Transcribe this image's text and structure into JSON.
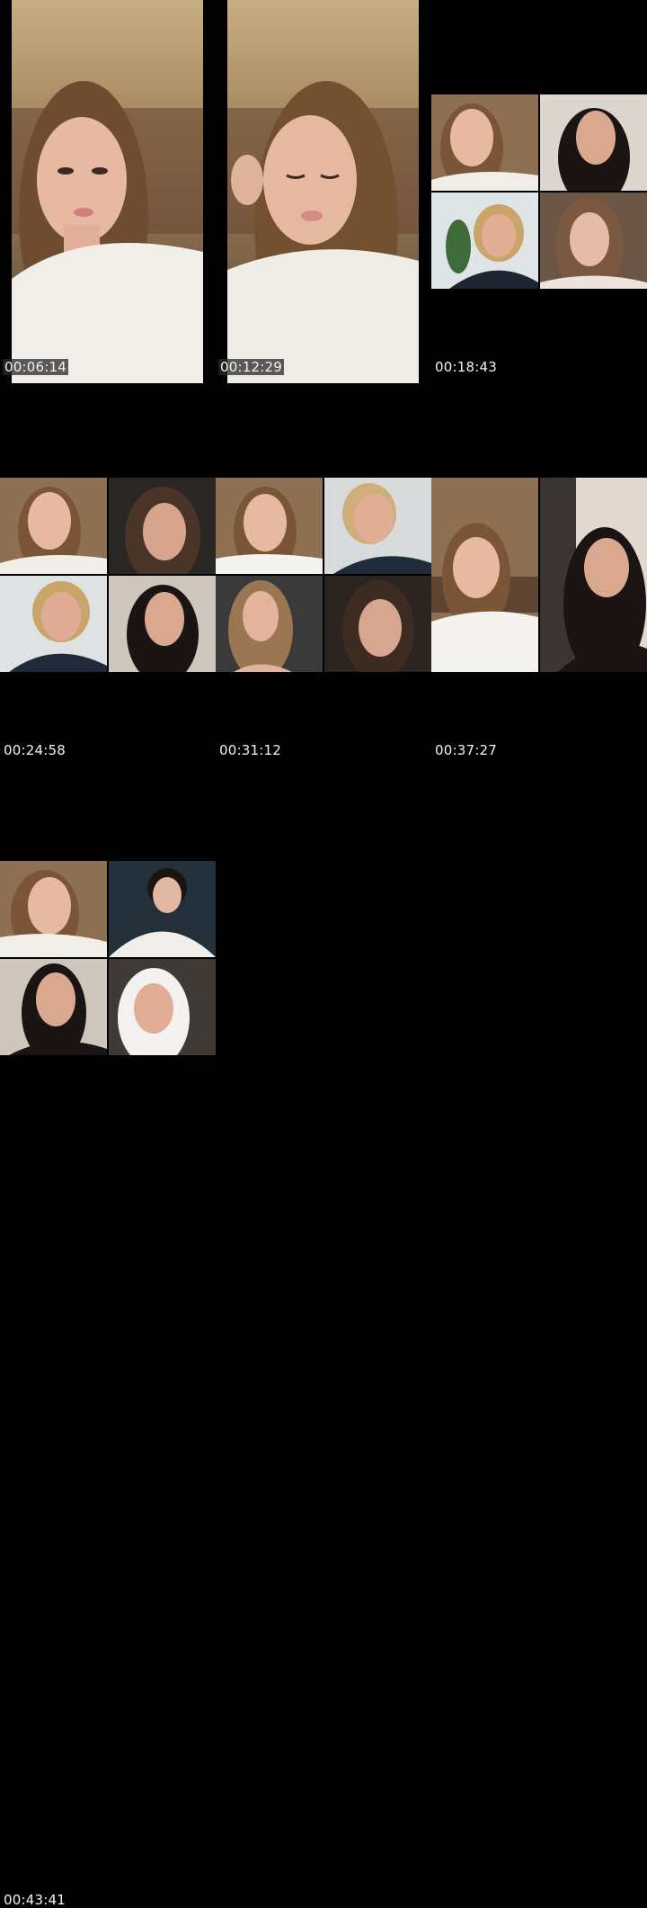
{
  "contact_sheet": {
    "thumbnails": [
      {
        "timestamp": "00:06:14"
      },
      {
        "timestamp": "00:12:29"
      },
      {
        "timestamp": "00:18:43"
      },
      {
        "timestamp": "00:24:58"
      },
      {
        "timestamp": "00:31:12"
      },
      {
        "timestamp": "00:37:27"
      },
      {
        "timestamp": "00:43:41"
      }
    ]
  },
  "palette": {
    "background": "#000000",
    "wall_warm": "#b89b72",
    "skin": "#e7b9a0",
    "hair_brown": "#7a5536",
    "hair_black": "#1a1412",
    "shirt_white": "#f1eee9"
  }
}
